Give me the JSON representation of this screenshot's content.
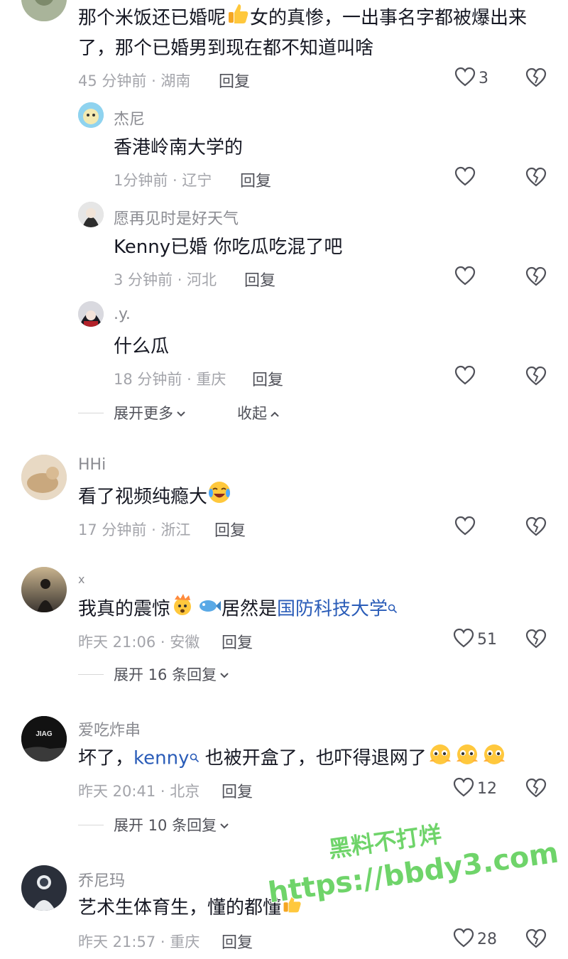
{
  "comments": [
    {
      "text_line1": "那个米饭还已婚呢",
      "text_line1b": "女的真惨，一出事名字都被爆出来",
      "text_line2": "了，那个已婚男到现在都不知道叫啥",
      "meta": "45 分钟前 · 湖南",
      "reply_label": "回复",
      "likes": "3"
    },
    {
      "username": "x",
      "text_a": "我真的震惊",
      "text_b": "居然是",
      "link": "国防科技大学",
      "meta": "昨天 21:06 · 安徽",
      "reply_label": "回复",
      "likes": "51",
      "expand": "展开 16 条回复"
    }
  ],
  "replies": [
    {
      "username": "杰尼",
      "text": "香港岭南大学的",
      "meta": "1分钟前 · 辽宁",
      "reply_label": "回复"
    },
    {
      "username": "愿再见时是好天气",
      "text": "Kenny已婚 你吃瓜吃混了吧",
      "meta": "3 分钟前 · 河北",
      "reply_label": "回复"
    },
    {
      "username": ".y.",
      "text": "什么瓜",
      "meta": "18 分钟前 · 重庆",
      "reply_label": "回复"
    }
  ],
  "thread_controls": {
    "expand_more": "展开更多",
    "collapse": "收起"
  },
  "comment_hhi": {
    "username": "HHi",
    "text": "看了视频纯瘾大",
    "meta": "17 分钟前 · 浙江",
    "reply_label": "回复"
  },
  "comment_ac": {
    "username": "爱吃炸串",
    "avatar_text": "JIAG",
    "text_a": "坏了，",
    "link": "kenny",
    "text_b": "也被开盒了，也吓得退网了",
    "meta": "昨天 20:41 · 北京",
    "reply_label": "回复",
    "likes": "12",
    "expand": "展开 10 条回复"
  },
  "comment_qnm": {
    "username": "乔尼玛",
    "text": "艺术生体育生，懂的都懂",
    "meta": "昨天 21:57 · 重庆",
    "reply_label": "回复",
    "likes": "28"
  },
  "watermark": {
    "line1": "黑料不打烊",
    "line2": "https://bbdy3.com"
  },
  "icons": {
    "like": "heart-outline-icon",
    "dislike": "broken-heart-icon",
    "search": "search-suffix-icon",
    "chevron_down": "chevron-down-icon",
    "chevron_up": "chevron-up-icon"
  },
  "colors": {
    "link": "#2a5cb8",
    "meta": "#a3a4aa",
    "text": "#161823",
    "watermark": "#6fd46a"
  }
}
